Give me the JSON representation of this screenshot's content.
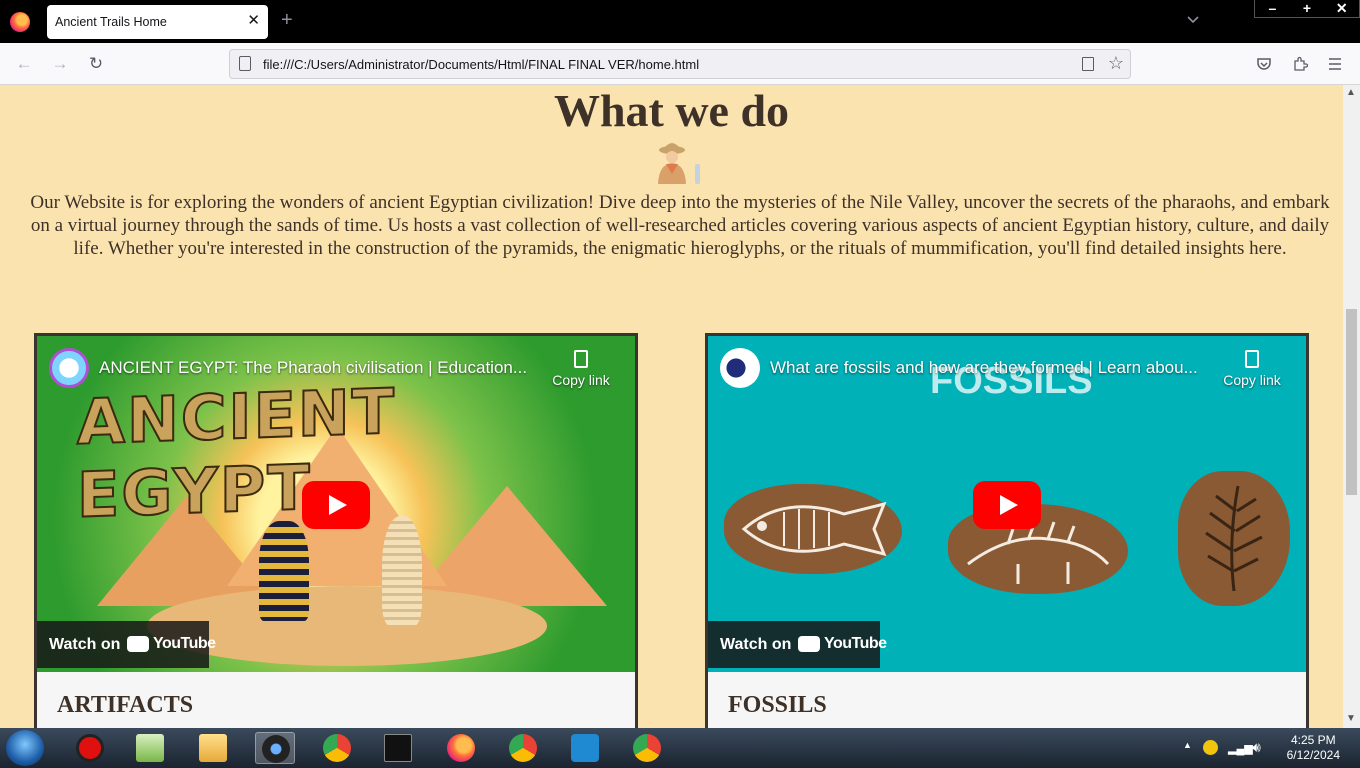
{
  "browser": {
    "tab_title": "Ancient Trails Home",
    "tab_close": "✕",
    "new_tab": "+",
    "url": "file:///C:/Users/Administrator/Documents/Html/FINAL FINAL VER/home.html",
    "window_controls": [
      "–",
      "+",
      "✕"
    ]
  },
  "page": {
    "heading": "What we do",
    "intro": "Our Website is for exploring the wonders of ancient Egyptian civilization! Dive deep into the mysteries of the Nile Valley, uncover the secrets of the pharaohs, and embark on a virtual journey through the sands of time. Us hosts a vast collection of well-researched articles covering various aspects of ancient Egyptian history, culture, and daily life. Whether you're interested in the construction of the pyramids, the enigmatic hieroglyphs, or the rituals of mummification, you'll find detailed insights here.",
    "cards": [
      {
        "video_title": "ANCIENT EGYPT: The Pharaoh civilisation | Education...",
        "copy_link": "Copy link",
        "thumbnail_text": "ANCIENT EGYPT",
        "watch_on": "Watch on",
        "youtube": "YouTube",
        "label": "ARTIFACTS"
      },
      {
        "video_title": "What are fossils and how are they formed | Learn abou...",
        "copy_link": "Copy link",
        "thumbnail_text": "FOSSILS",
        "watch_on": "Watch on",
        "youtube": "YouTube",
        "label": "FOSSILS"
      }
    ]
  },
  "taskbar": {
    "time": "4:25 PM",
    "date": "6/12/2024"
  },
  "colors": {
    "page_bg": "#fbe3b0",
    "text": "#3d3128",
    "card_border": "#3a3430",
    "play_red": "#ff0000"
  }
}
